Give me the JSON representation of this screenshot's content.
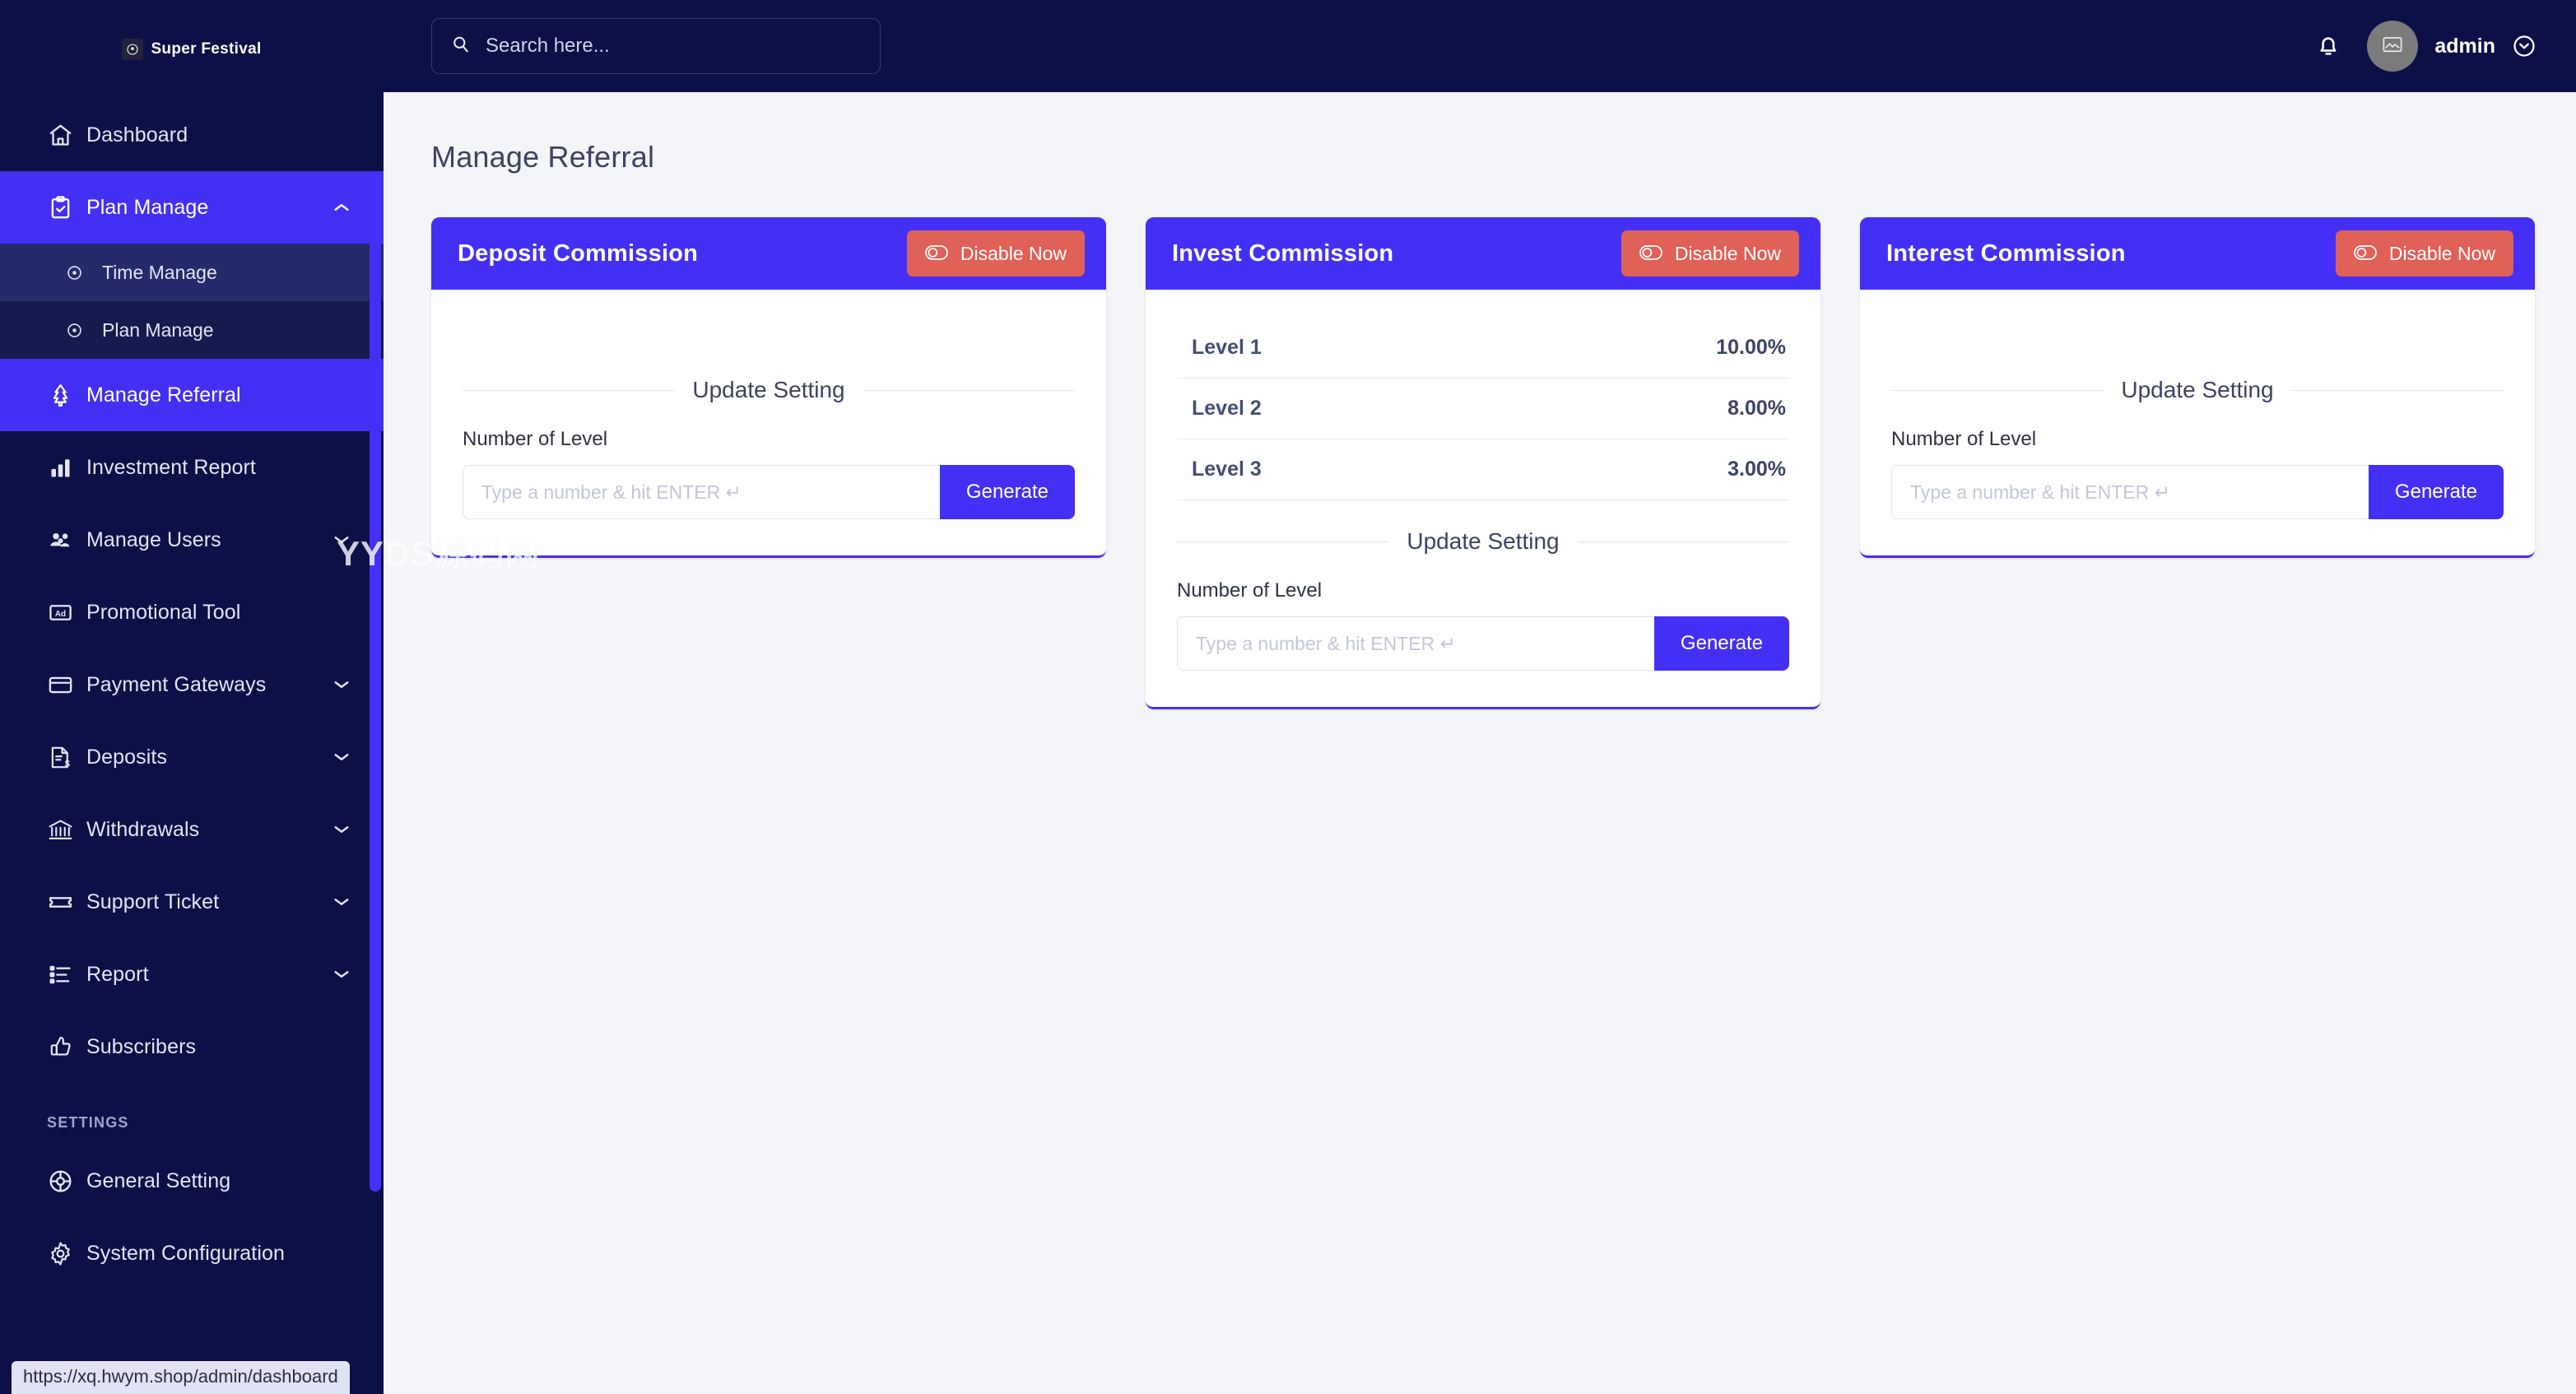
{
  "brand": {
    "name": "Super Festival",
    "badge_icon": "soccer-ball-icon"
  },
  "topbar": {
    "search": {
      "placeholder": "Search here...",
      "value": "",
      "icon": "search-icon"
    },
    "bell_icon": "bell-icon",
    "avatar_icon": "broken-image-icon",
    "user_name": "admin",
    "caret_icon": "chevron-down-circle-icon"
  },
  "sidebar": {
    "items": [
      {
        "label": "Dashboard",
        "icon": "home-icon",
        "active": false,
        "expandable": false
      },
      {
        "label": "Plan Manage",
        "icon": "clipboard-check-icon",
        "active": true,
        "expandable": true,
        "expanded": true
      },
      {
        "label": "Manage Referral",
        "icon": "tree-icon",
        "active": true,
        "expandable": false
      },
      {
        "label": "Investment Report",
        "icon": "bar-chart-icon",
        "active": false,
        "expandable": false
      },
      {
        "label": "Manage Users",
        "icon": "users-icon",
        "active": false,
        "expandable": true
      },
      {
        "label": "Promotional Tool",
        "icon": "ad-icon",
        "active": false,
        "expandable": false
      },
      {
        "label": "Payment Gateways",
        "icon": "credit-card-icon",
        "active": false,
        "expandable": true
      },
      {
        "label": "Deposits",
        "icon": "document-dollar-icon",
        "active": false,
        "expandable": true
      },
      {
        "label": "Withdrawals",
        "icon": "bank-icon",
        "active": false,
        "expandable": true
      },
      {
        "label": "Support Ticket",
        "icon": "ticket-icon",
        "active": false,
        "expandable": true
      },
      {
        "label": "Report",
        "icon": "list-icon",
        "active": false,
        "expandable": true
      },
      {
        "label": "Subscribers",
        "icon": "thumbs-up-icon",
        "active": false,
        "expandable": false
      }
    ],
    "submenu": [
      {
        "label": "Time Manage",
        "icon": "dot-circle-icon"
      },
      {
        "label": "Plan Manage",
        "icon": "dot-circle-icon"
      }
    ],
    "section_label": "SETTINGS",
    "settings_items": [
      {
        "label": "General Setting",
        "icon": "color-wheel-icon"
      },
      {
        "label": "System Configuration",
        "icon": "gear-icon"
      }
    ]
  },
  "main": {
    "page_title": "Manage Referral",
    "cards": [
      {
        "title": "Deposit Commission",
        "disable_label": "Disable Now",
        "toggle_icon": "toggle-off-icon",
        "levels": [],
        "update_setting_label": "Update Setting",
        "field_label": "Number of Level",
        "input_placeholder": "Type a number & hit ENTER ↵",
        "input_value": "",
        "generate_label": "Generate"
      },
      {
        "title": "Invest Commission",
        "disable_label": "Disable Now",
        "toggle_icon": "toggle-off-icon",
        "levels": [
          {
            "name": "Level 1",
            "value": "10.00%"
          },
          {
            "name": "Level 2",
            "value": "8.00%"
          },
          {
            "name": "Level 3",
            "value": "3.00%"
          }
        ],
        "update_setting_label": "Update Setting",
        "field_label": "Number of Level",
        "input_placeholder": "Type a number & hit ENTER ↵",
        "input_value": "",
        "generate_label": "Generate"
      },
      {
        "title": "Interest Commission",
        "disable_label": "Disable Now",
        "toggle_icon": "toggle-off-icon",
        "levels": [],
        "update_setting_label": "Update Setting",
        "field_label": "Number of Level",
        "input_placeholder": "Type a number & hit ENTER ↵",
        "input_value": "",
        "generate_label": "Generate"
      }
    ]
  },
  "watermark": "YYDS源码网",
  "status_bar": {
    "url": "https://xq.hwym.shop/admin/dashboard"
  },
  "colors": {
    "sidebar_bg": "#0d1046",
    "accent_blue": "#4430f4",
    "danger_red": "#df6158",
    "page_bg": "#f4f5f9"
  }
}
